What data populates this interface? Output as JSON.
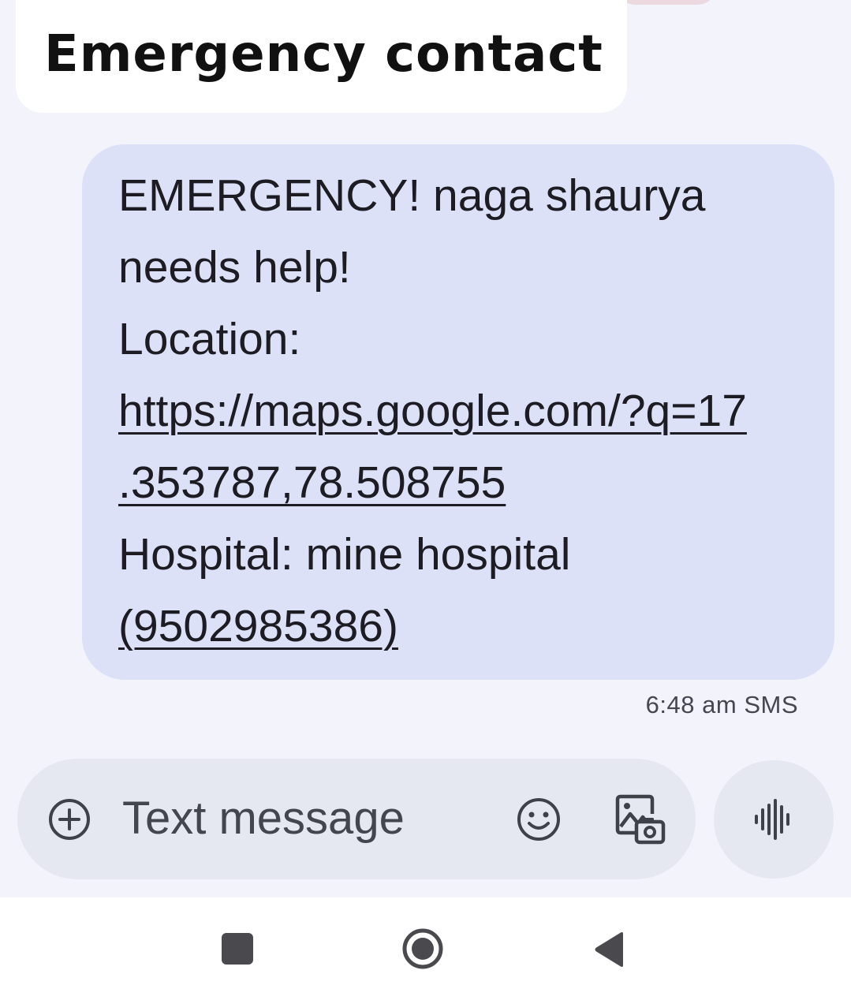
{
  "caption": {
    "title": "Emergency contact"
  },
  "message": {
    "lines": [
      "EMERGENCY! naga shaurya",
      "needs help!",
      "Location:"
    ],
    "map_link_line1": "https://maps.google.com/?q=17",
    "map_link_line2": ".353787,78.508755",
    "hospital_line": "Hospital: mine hospital",
    "phone_link": "(9502985386)",
    "timestamp": "6:48 am",
    "channel": "SMS"
  },
  "composer": {
    "placeholder": "Text message",
    "icons": {
      "attach": "plus-circle-icon",
      "emoji": "emoji-icon",
      "media": "gallery-icon",
      "voice": "voice-waveform-icon"
    }
  },
  "navbar": {
    "icons": [
      "recent-apps-icon",
      "home-icon",
      "back-icon"
    ]
  },
  "colors": {
    "background": "#f3f4fb",
    "bubble": "#dce1f8",
    "composer": "#e5e7f1",
    "text": "#1c1c22"
  }
}
